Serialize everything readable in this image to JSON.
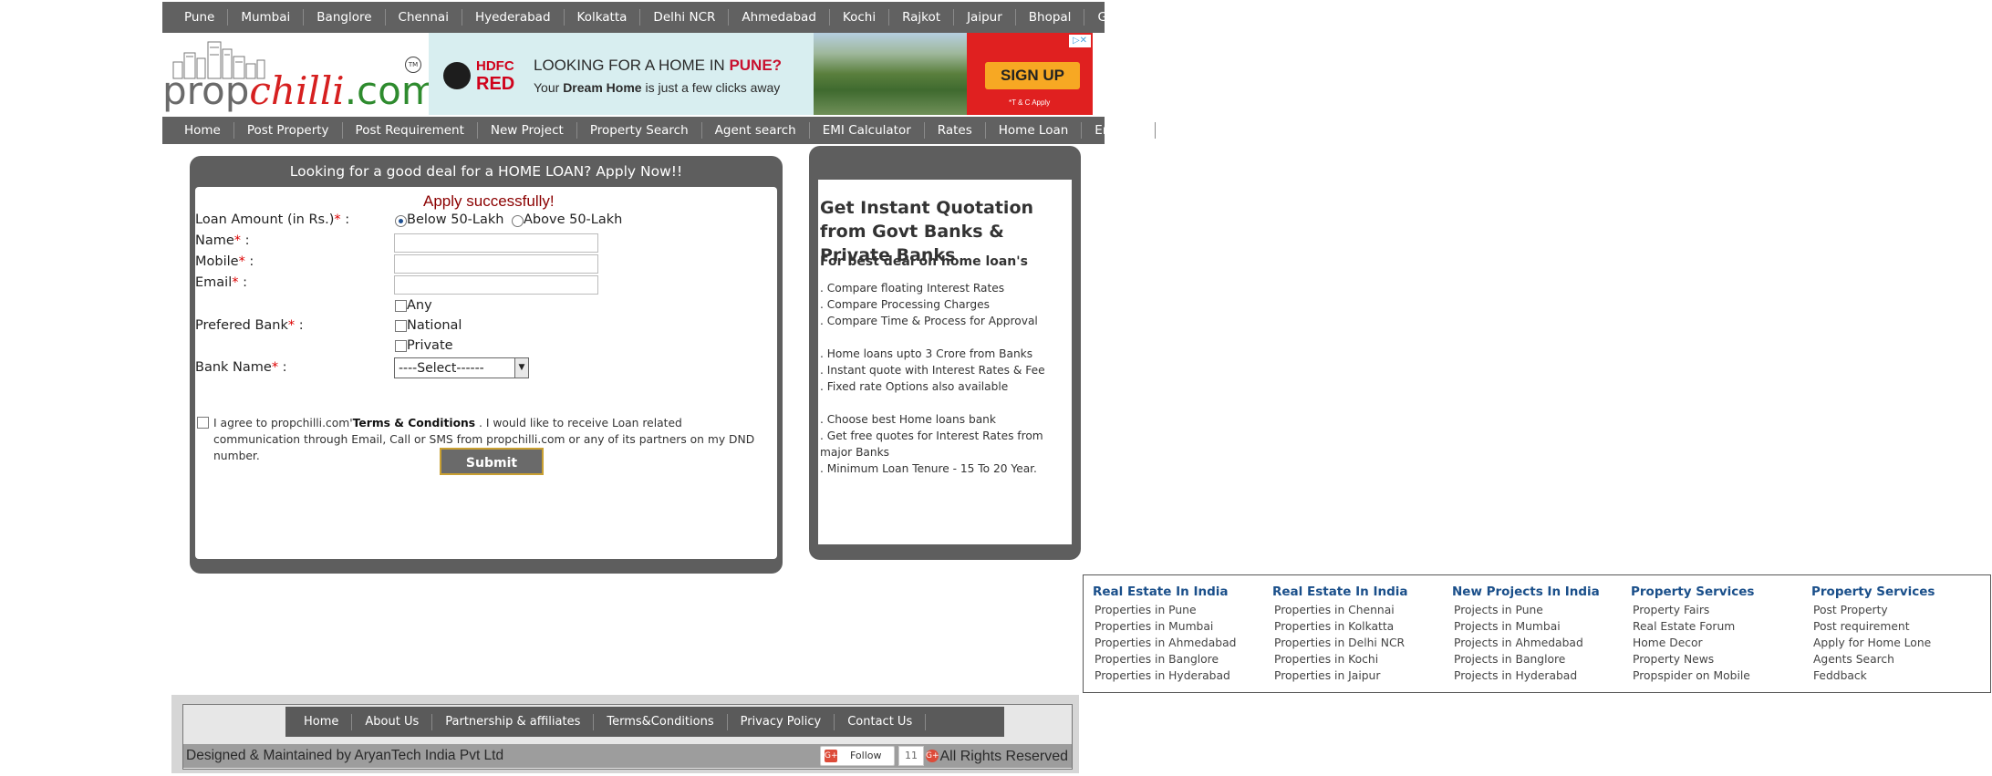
{
  "cities": [
    "Pune",
    "Mumbai",
    "Banglore",
    "Chennai",
    "Hyederabad",
    "Kolkatta",
    "Delhi NCR",
    "Ahmedabad",
    "Kochi",
    "Rajkot",
    "Jaipur",
    "Bhopal",
    "Goa"
  ],
  "logo": {
    "prop": "prop",
    "chilli": "chilli",
    ".com": ".com",
    "tm": "TM"
  },
  "ad": {
    "brand_top": "HDFC",
    "brand_bottom": "RED",
    "headline_prefix": "LOOKING FOR  A HOME IN ",
    "headline_city": "PUNE?",
    "subline_a": "Your ",
    "subline_b": "Dream Home",
    "subline_c": " is just a few clicks away",
    "cta": "SIGN UP",
    "tc": "*T & C Apply",
    "adchoices": "▷✕"
  },
  "nav": [
    "Home",
    "Post Property",
    "Post Requirement",
    "New Project",
    "Property Search",
    "Agent search",
    "EMI Calculator",
    "Rates",
    "Home Loan",
    "Enquiry"
  ],
  "loan_form": {
    "title": "Looking for a good deal for a HOME LOAN? Apply Now!!",
    "success": "Apply successfully!",
    "loan_amount_label": "Loan Amount (in Rs.)",
    "opt1": "Below 50-Lakh",
    "opt2": "Above 50-Lakh",
    "name_label": "Name",
    "mobile_label": "Mobile",
    "email_label": "Email",
    "bank_pref_label": "Prefered Bank",
    "bank_any": "Any",
    "bank_national": "National",
    "bank_private": "Private",
    "bank_name_label": "Bank Name",
    "bank_name_selected": "----Select------",
    "agree_a": "I agree to propchilli.com'",
    "agree_terms": "Terms & Conditions",
    "agree_b": " . I would like to receive Loan related communication through Email, Call or SMS from propchilli.com or any of its partners on my DND number.",
    "submit": "Submit Details"
  },
  "quotation": {
    "heading": "Get Instant Quotation from Govt Banks & Private Banks",
    "subheading": "For best deal on home loan's",
    "items": [
      ". Compare floating Interest Rates",
      ". Compare Processing Charges",
      ". Compare Time & Process for Approval",
      ". Home loans upto 3 Crore from Banks",
      ". Instant quote with Interest Rates & Fee",
      ". Fixed rate Options also available",
      ". Choose best Home loans bank",
      ". Get free quotes for Interest Rates from major Banks",
      ". Minimum Loan Tenure - 15 To 20 Year."
    ]
  },
  "link_columns": [
    {
      "heading": "Real Estate In India",
      "links": [
        "Properties in Pune",
        "Properties in  Mumbai",
        "Properties in Ahmedabad",
        "Properties in Banglore",
        "Properties in Hyderabad"
      ]
    },
    {
      "heading": "Real Estate In India",
      "links": [
        "Properties in Chennai",
        "Properties in Kolkatta",
        "Properties in Delhi NCR",
        "Properties in Kochi",
        "Properties in Jaipur"
      ]
    },
    {
      "heading": "New Projects In India",
      "links": [
        "Projects in Pune",
        "Projects in Mumbai",
        "Projects in Ahmedabad",
        "Projects in Banglore",
        "Projects in Hyderabad"
      ]
    },
    {
      "heading": "Property Services",
      "links": [
        "Property Fairs",
        "Real Estate Forum",
        "Home Decor",
        "Property News",
        "Propspider on Mobile"
      ]
    },
    {
      "heading": "Property Services",
      "links": [
        "Post Property",
        "Post requirement",
        "Apply for Home Lone",
        "Agents Search",
        "Feddback"
      ]
    }
  ],
  "footer": {
    "nav": [
      "Home",
      "About Us",
      "Partnership & affiliates",
      "Terms&Conditions",
      "Privacy Policy",
      "Contact Us"
    ],
    "designed": "Designed & Maintained by AryanTech India Pvt Ltd",
    "follow": "Follow",
    "follow_count": "11",
    "rights": "All Rights Reserved"
  }
}
